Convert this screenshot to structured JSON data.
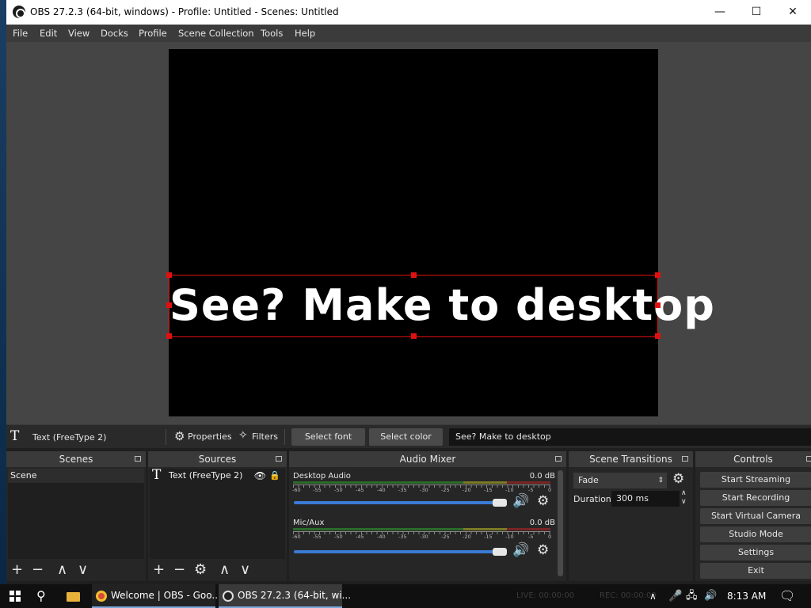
{
  "window": {
    "title": "OBS 27.2.3 (64-bit, windows) - Profile: Untitled - Scenes: Untitled",
    "minimize": "—",
    "maximize": "☐",
    "close": "✕"
  },
  "menu": [
    "File",
    "Edit",
    "View",
    "Docks",
    "Profile",
    "Scene Collection",
    "Tools",
    "Help"
  ],
  "preview": {
    "text": "See? Make to desktop"
  },
  "source_toolbar": {
    "source_name": "Text (FreeType 2)",
    "properties_label": "Properties",
    "filters_label": "Filters",
    "select_font_label": "Select font",
    "select_color_label": "Select color",
    "text_value": "See? Make to desktop"
  },
  "docks": {
    "scenes": {
      "title": "Scenes",
      "items": [
        "Scene"
      ]
    },
    "sources": {
      "title": "Sources",
      "items": [
        "Text (FreeType 2)"
      ]
    },
    "audio_mixer": {
      "title": "Audio Mixer",
      "tick_labels": [
        "-60",
        "-55",
        "-50",
        "-45",
        "-40",
        "-35",
        "-30",
        "-25",
        "-20",
        "-15",
        "-10",
        "-5",
        "0"
      ],
      "tracks": [
        {
          "name": "Desktop Audio",
          "level": "0.0 dB",
          "volume_fraction": 0.95
        },
        {
          "name": "Mic/Aux",
          "level": "0.0 dB",
          "volume_fraction": 0.95
        }
      ]
    },
    "scene_transitions": {
      "title": "Scene Transitions",
      "transition": "Fade",
      "duration_label": "Duration",
      "duration_value": "300 ms"
    },
    "controls": {
      "title": "Controls",
      "buttons": [
        "Start Streaming",
        "Start Recording",
        "Start Virtual Camera",
        "Studio Mode",
        "Settings",
        "Exit"
      ]
    }
  },
  "status": {
    "live": "LIVE: 00:00:00",
    "rec": "REC: 00:00:00"
  },
  "taskbar": {
    "items": [
      "Welcome | OBS - Goo...",
      "OBS 27.2.3 (64-bit, wi..."
    ],
    "time": "8:13 AM"
  },
  "icons": {
    "text_source": "T",
    "add": "+",
    "remove": "−",
    "up": "∧",
    "down": "∨",
    "gear": "⚙",
    "speaker": "🔊",
    "eye": "👁",
    "lock": "🔒"
  },
  "colors": {
    "selection": "#e01010",
    "volume_slider": "#3a7bd5",
    "panel": "#262626"
  }
}
